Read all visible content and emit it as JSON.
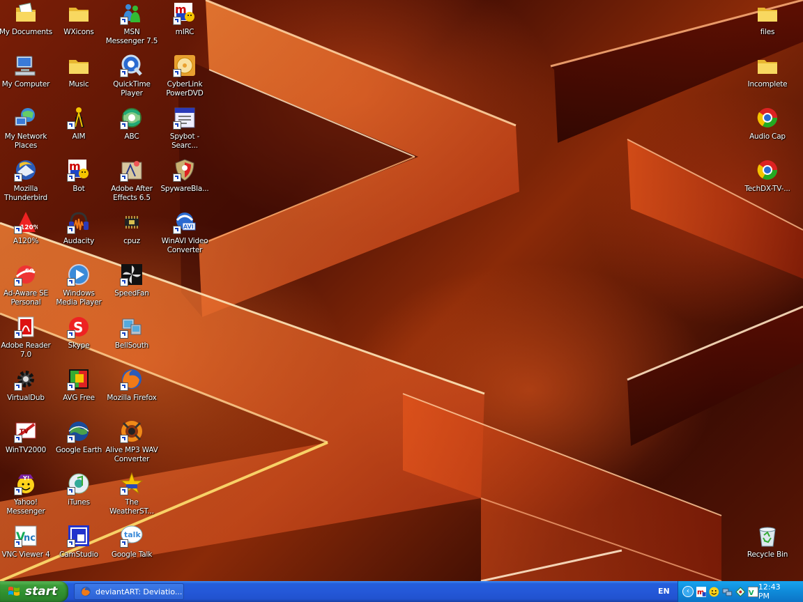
{
  "desktop": {
    "icons": [
      {
        "id": "my-documents",
        "label": "My Documents",
        "icon": "folder-letter-icon",
        "shortcut": false
      },
      {
        "id": "my-computer",
        "label": "My Computer",
        "icon": "computer-icon",
        "shortcut": false
      },
      {
        "id": "my-network-places",
        "label": "My Network\nPlaces",
        "icon": "network-icon",
        "shortcut": false
      },
      {
        "id": "mozilla-thunderbird",
        "label": "Mozilla\nThunderbird",
        "icon": "thunderbird-icon",
        "shortcut": true
      },
      {
        "id": "a120",
        "label": "A120%",
        "icon": "alcohol-icon",
        "shortcut": true
      },
      {
        "id": "ad-aware",
        "label": "Ad-Aware SE\nPersonal",
        "icon": "adaware-icon",
        "shortcut": true
      },
      {
        "id": "adobe-reader",
        "label": "Adobe Reader\n7.0",
        "icon": "adobe-reader-icon",
        "shortcut": true
      },
      {
        "id": "virtualdub",
        "label": "VirtualDub",
        "icon": "gear-icon",
        "shortcut": true
      },
      {
        "id": "wintv2000",
        "label": "WinTV2000",
        "icon": "tv-icon",
        "shortcut": true
      },
      {
        "id": "yahoo-messenger",
        "label": "Yahoo!\nMessenger",
        "icon": "yahoo-icon",
        "shortcut": true
      },
      {
        "id": "vnc-viewer",
        "label": "VNC Viewer 4",
        "icon": "vnc-icon",
        "shortcut": true
      },
      {
        "id": "wxicons",
        "label": "WXicons",
        "icon": "folder-icon",
        "shortcut": false
      },
      {
        "id": "music",
        "label": "Music",
        "icon": "folder-icon",
        "shortcut": false
      },
      {
        "id": "aim",
        "label": "AIM",
        "icon": "aim-icon",
        "shortcut": true
      },
      {
        "id": "bot",
        "label": "Bot",
        "icon": "mirc-icon",
        "shortcut": true
      },
      {
        "id": "audacity",
        "label": "Audacity",
        "icon": "audacity-icon",
        "shortcut": true
      },
      {
        "id": "windows-media-player",
        "label": "Windows\nMedia Player",
        "icon": "media-player-icon",
        "shortcut": true
      },
      {
        "id": "skype",
        "label": "Skype",
        "icon": "skype-icon",
        "shortcut": true
      },
      {
        "id": "avg-free",
        "label": "AVG Free",
        "icon": "avg-icon",
        "shortcut": true
      },
      {
        "id": "google-earth",
        "label": "Google Earth",
        "icon": "globe-icon",
        "shortcut": true
      },
      {
        "id": "itunes",
        "label": "iTunes",
        "icon": "itunes-icon",
        "shortcut": true
      },
      {
        "id": "camstudio",
        "label": "CamStudio",
        "icon": "camstudio-icon",
        "shortcut": true
      },
      {
        "id": "msn-messenger",
        "label": "MSN\nMessenger 7.5",
        "icon": "msn-icon",
        "shortcut": true
      },
      {
        "id": "quicktime",
        "label": "QuickTime\nPlayer",
        "icon": "quicktime-icon",
        "shortcut": true
      },
      {
        "id": "abc",
        "label": "ABC",
        "icon": "abc-icon",
        "shortcut": true
      },
      {
        "id": "after-effects",
        "label": "Adobe After\nEffects 6.5",
        "icon": "after-effects-icon",
        "shortcut": true
      },
      {
        "id": "cpuz",
        "label": "cpuz",
        "icon": "chip-icon",
        "shortcut": false
      },
      {
        "id": "speedfan",
        "label": "SpeedFan",
        "icon": "fan-icon",
        "shortcut": true
      },
      {
        "id": "bellsouth",
        "label": "BellSouth",
        "icon": "bellsouth-icon",
        "shortcut": true
      },
      {
        "id": "mozilla-firefox",
        "label": "Mozilla Firefox",
        "icon": "firefox-icon",
        "shortcut": true
      },
      {
        "id": "alive-mp3",
        "label": "Alive MP3 WAV\nConverter",
        "icon": "converter-icon",
        "shortcut": true
      },
      {
        "id": "weatherst",
        "label": "The\nWeatherST...",
        "icon": "star-icon",
        "shortcut": true
      },
      {
        "id": "google-talk",
        "label": "Google Talk",
        "icon": "talk-icon",
        "shortcut": true
      },
      {
        "id": "mirc",
        "label": "mIRC",
        "icon": "mirc-icon",
        "shortcut": true
      },
      {
        "id": "powerdvd",
        "label": "CyberLink\nPowerDVD",
        "icon": "dvd-icon",
        "shortcut": true
      },
      {
        "id": "spybot",
        "label": "Spybot -\nSearc...",
        "icon": "spybot-icon",
        "shortcut": true
      },
      {
        "id": "spywareblaster",
        "label": "SpywareBla...",
        "icon": "shield-icon",
        "shortcut": true
      },
      {
        "id": "winavi",
        "label": "WinAVI Video\nConverter",
        "icon": "winavi-icon",
        "shortcut": true
      },
      {
        "id": "files",
        "label": "files",
        "icon": "folder-icon",
        "shortcut": false
      },
      {
        "id": "incomplete",
        "label": "Incomplete",
        "icon": "folder-icon",
        "shortcut": false
      },
      {
        "id": "audio-cap",
        "label": "Audio Cap",
        "icon": "chrome-icon",
        "shortcut": false
      },
      {
        "id": "techdx-tv",
        "label": "TechDX-TV-...",
        "icon": "chrome-icon",
        "shortcut": false
      },
      {
        "id": "recycle-bin",
        "label": "Recycle Bin",
        "icon": "recycle-bin-icon",
        "shortcut": false
      }
    ]
  },
  "taskbar": {
    "start_label": "start",
    "task_item": {
      "label": "deviantART: Deviatio...",
      "icon": "firefox-icon"
    },
    "language": "EN",
    "tray_icons": [
      "mirc-icon",
      "yahoo-icon",
      "network-icon",
      "shield-icon",
      "vnc-icon"
    ],
    "clock": "12:43 PM"
  },
  "colors": {
    "taskbar_blue": "#245edb",
    "start_green": "#3c9c39",
    "tray_blue": "#0f8ad9"
  }
}
